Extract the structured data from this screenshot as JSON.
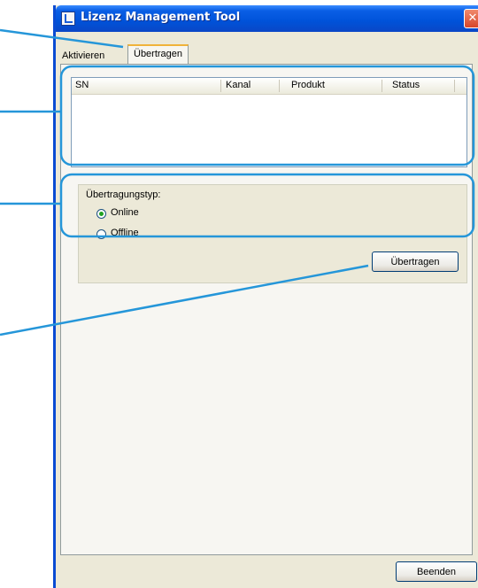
{
  "window": {
    "title": "Lizenz Management Tool",
    "close_glyph": "✕"
  },
  "tabs": [
    {
      "label": "Aktivieren"
    },
    {
      "label": "Übertragen"
    }
  ],
  "list": {
    "columns": [
      "SN",
      "Kanal",
      "Produkt",
      "Status"
    ]
  },
  "transfer_type": {
    "legend": "Übertragungstyp:",
    "options": [
      {
        "label": "Online",
        "selected": true
      },
      {
        "label": "Offline",
        "selected": false
      }
    ]
  },
  "buttons": {
    "transfer_label": "Übertragen",
    "exit_label": "Beenden"
  },
  "colors": {
    "title_bar": "#0052d9",
    "window_bg": "#ece9d8",
    "callout_blue": "#2596d9",
    "close_red": "#d7452a"
  }
}
